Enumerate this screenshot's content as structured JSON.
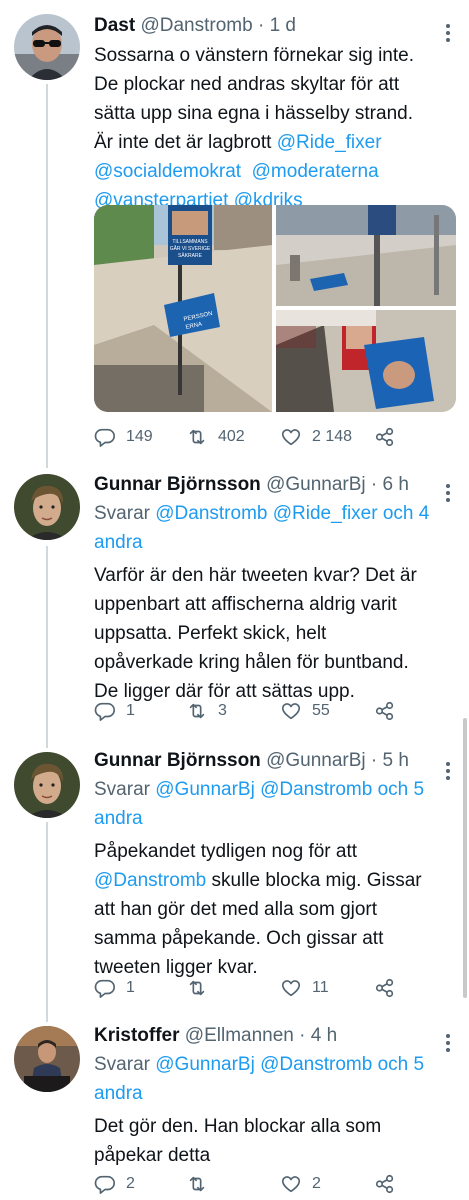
{
  "tweets": [
    {
      "name": "Dast",
      "handle": "@Danstromb",
      "time": "· 1 d",
      "text_lines": [
        [
          {
            "t": "Sossarna o vänstern förnekar sig inte."
          }
        ],
        [
          {
            "t": "De plockar ned andras skyltar för att"
          }
        ],
        [
          {
            "t": "sätta upp sina egna i hässelby strand."
          }
        ],
        [
          {
            "t": "Är inte det är lagbrott "
          },
          {
            "t": "@Ride_fixer",
            "l": true
          }
        ],
        [
          {
            "t": "@socialdemokrat",
            "l": true
          },
          {
            "t": "  "
          },
          {
            "t": "@moderaterna",
            "l": true
          }
        ],
        [
          {
            "t": "@vansterpartiet",
            "l": true
          },
          {
            "t": " "
          },
          {
            "t": "@kdriks",
            "l": true
          }
        ]
      ],
      "replies": "149",
      "retweets": "402",
      "likes": "2 148",
      "media_poster_text": [
        "TILLSAMMANS",
        "GÅR VI SVERIGE",
        "SÄKRARE",
        "PERSSON",
        "ERNA"
      ]
    },
    {
      "name": "Gunnar Björnsson",
      "handle": "@GunnarBj",
      "time": "· 6 h",
      "reply_lines": [
        [
          {
            "t": "Svarar "
          },
          {
            "t": "@Danstromb @Ride_fixer och 4",
            "l": true
          }
        ],
        [
          {
            "t": "andra",
            "l": true
          }
        ]
      ],
      "text_lines": [
        [
          {
            "t": "Varför är den här tweeten kvar? Det är"
          }
        ],
        [
          {
            "t": "uppenbart att affischerna aldrig varit"
          }
        ],
        [
          {
            "t": "uppsatta. Perfekt skick, helt"
          }
        ],
        [
          {
            "t": "opåverkade kring hålen för buntband."
          }
        ],
        [
          {
            "t": "De ligger där för att sättas upp."
          }
        ]
      ],
      "replies": "1",
      "retweets": "3",
      "likes": "55"
    },
    {
      "name": "Gunnar Björnsson",
      "handle": "@GunnarBj",
      "time": "· 5 h",
      "reply_lines": [
        [
          {
            "t": "Svarar "
          },
          {
            "t": "@GunnarBj @Danstromb och 5",
            "l": true
          }
        ],
        [
          {
            "t": "andra",
            "l": true
          }
        ]
      ],
      "text_lines": [
        [
          {
            "t": "Påpekandet tydligen nog för att"
          }
        ],
        [
          {
            "t": "@Danstromb",
            "l": true
          },
          {
            "t": " skulle blocka mig. Gissar"
          }
        ],
        [
          {
            "t": "att han gör det med alla som gjort"
          }
        ],
        [
          {
            "t": "samma påpekande. Och gissar att"
          }
        ],
        [
          {
            "t": "tweeten ligger kvar."
          }
        ]
      ],
      "replies": "1",
      "retweets": "",
      "likes": "11"
    },
    {
      "name": "Kristoffer",
      "handle": "@Ellmannen",
      "time": "· 4 h",
      "reply_lines": [
        [
          {
            "t": "Svarar "
          },
          {
            "t": "@GunnarBj @Danstromb och 5",
            "l": true
          }
        ],
        [
          {
            "t": "andra",
            "l": true
          }
        ]
      ],
      "text_lines": [
        [
          {
            "t": "Det gör den. Han blockar alla som"
          }
        ],
        [
          {
            "t": "påpekar detta"
          }
        ]
      ],
      "replies": "2",
      "retweets": "",
      "likes": "2"
    }
  ],
  "colors": {
    "link": "#1d9bf0",
    "muted": "#536471",
    "text": "#0f1419",
    "thread": "#cfd9de"
  },
  "icons": [
    "reply-icon",
    "retweet-icon",
    "like-icon",
    "share-icon",
    "more-icon"
  ]
}
